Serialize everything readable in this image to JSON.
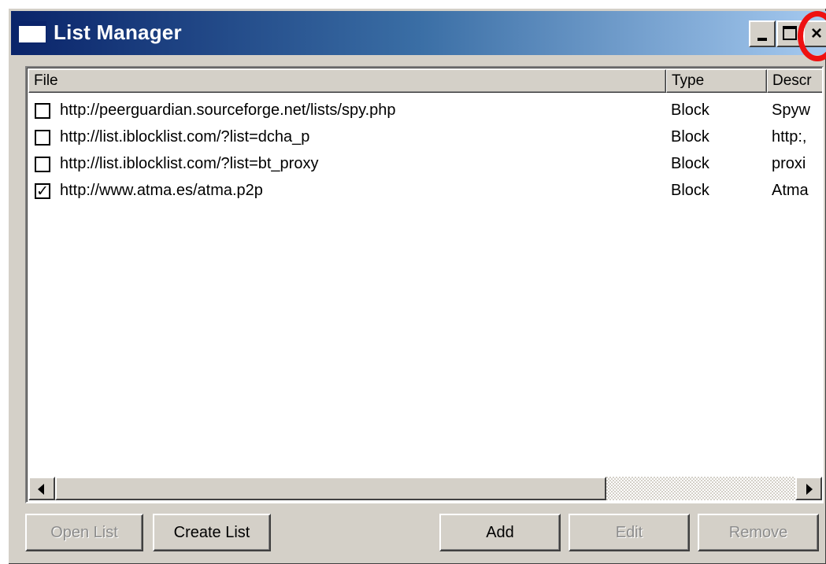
{
  "window": {
    "title": "List Manager",
    "close_symbol": "×",
    "highlight_color": "#ee1111"
  },
  "list": {
    "columns": [
      "File",
      "Type",
      "Descr"
    ],
    "rows": [
      {
        "checked": false,
        "file": "http://peerguardian.sourceforge.net/lists/spy.php",
        "type": "Block",
        "description": "Spyw"
      },
      {
        "checked": false,
        "file": "http://list.iblocklist.com/?list=dcha_p",
        "type": "Block",
        "description": "http:,"
      },
      {
        "checked": false,
        "file": "http://list.iblocklist.com/?list=bt_proxy",
        "type": "Block",
        "description": "proxi"
      },
      {
        "checked": true,
        "file": "http://www.atma.es/atma.p2p",
        "type": "Block",
        "description": "Atma"
      }
    ]
  },
  "buttons": {
    "open_list": "Open List",
    "create_list": "Create List",
    "add": "Add",
    "edit": "Edit",
    "remove": "Remove"
  },
  "icons": {
    "app": "window-icon",
    "minimize": "minimize-icon",
    "maximize": "maximize-icon",
    "close": "close-icon",
    "checkmark": "checkmark-icon"
  }
}
